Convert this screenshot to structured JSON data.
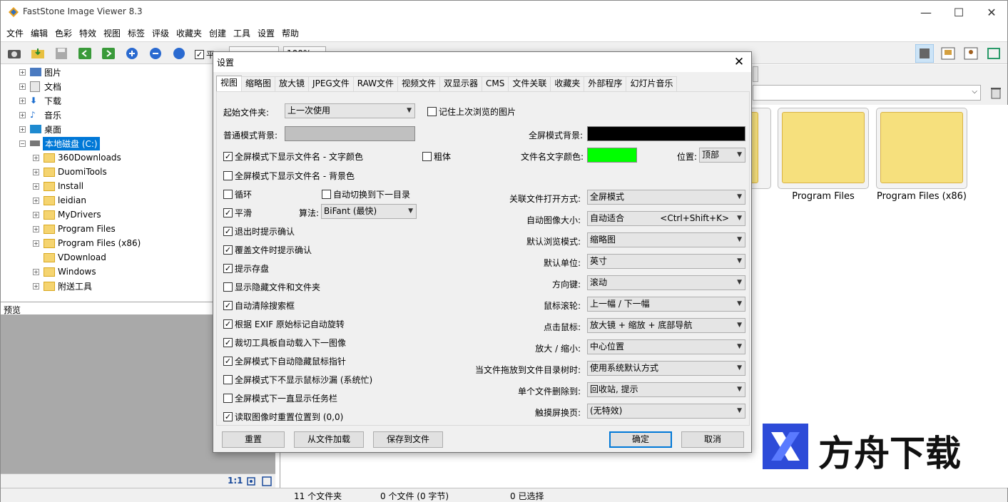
{
  "window": {
    "title": "FastStone Image Viewer 8.3",
    "minimize": "—",
    "maximize": "☐",
    "close": "✕"
  },
  "menu": [
    "文件",
    "编辑",
    "色彩",
    "特效",
    "视图",
    "标签",
    "评级",
    "收藏夹",
    "创建",
    "工具",
    "设置",
    "帮助"
  ],
  "toolbar": {
    "smooth_label": "平",
    "zoom_value": "100%"
  },
  "tree": {
    "top": [
      {
        "label": "图片"
      },
      {
        "label": "文档"
      },
      {
        "label": "下载"
      },
      {
        "label": "音乐"
      },
      {
        "label": "桌面"
      }
    ],
    "drive": "本地磁盘 (C:)",
    "folders": [
      "360Downloads",
      "DuomiTools",
      "Install",
      "leidian",
      "MyDrivers",
      "Program Files",
      "Program Files (x86)",
      "VDownload",
      "Windows",
      "附送工具"
    ]
  },
  "preview": {
    "title": "预览",
    "ratio": "1:1"
  },
  "thumbnails": [
    "Program Files",
    "Program Files (x86)"
  ],
  "status": {
    "folders": "11 个文件夹",
    "files": "0 个文件 (0 字节)",
    "selected": "0 已选择"
  },
  "dialog": {
    "title": "设置",
    "close": "✕",
    "tabs": [
      "视图",
      "缩略图",
      "放大镜",
      "JPEG文件",
      "RAW文件",
      "视频文件",
      "双显示器",
      "CMS",
      "文件关联",
      "收藏夹",
      "外部程序",
      "幻灯片音乐"
    ],
    "start_folder_label": "起始文件夹:",
    "start_folder_value": "上一次使用",
    "remember_last": "记住上次浏览的图片",
    "normal_bg_label": "普通模式背景:",
    "full_bg_label": "全屏模式背景:",
    "show_filename_text": "全屏模式下显示文件名 - 文字颜色",
    "bold": "粗体",
    "filename_color_label": "文件名文字颜色:",
    "position_label": "位置:",
    "position_value": "顶部",
    "show_filename_bg": "全屏模式下显示文件名 - 背景色",
    "loop": "循环",
    "auto_next_dir": "自动切换到下一目录",
    "smooth": "平滑",
    "algo_label": "算法:",
    "algo_value": "BiFant (最快)",
    "checks": [
      {
        "label": "退出时提示确认",
        "checked": true
      },
      {
        "label": "覆盖文件时提示确认",
        "checked": true
      },
      {
        "label": "提示存盘",
        "checked": true
      },
      {
        "label": "显示隐藏文件和文件夹",
        "checked": false
      },
      {
        "label": "自动清除搜索框",
        "checked": true
      },
      {
        "label": "根据 EXIF 原始标记自动旋转",
        "checked": true
      },
      {
        "label": "裁切工具板自动载入下一图像",
        "checked": true
      },
      {
        "label": "全屏模式下自动隐藏鼠标指针",
        "checked": true
      },
      {
        "label": "全屏模式下不显示鼠标沙漏 (系统忙)",
        "checked": false
      },
      {
        "label": "全屏模式下一直显示任务栏",
        "checked": false
      },
      {
        "label": "读取图像时重置位置到 (0,0)",
        "checked": true
      }
    ],
    "right_rows": [
      {
        "label": "关联文件打开方式:",
        "value": "全屏模式"
      },
      {
        "label": "自动图像大小:",
        "value": "自动适合",
        "hint": "<Ctrl+Shift+K>"
      },
      {
        "label": "默认浏览模式:",
        "value": "缩略图"
      },
      {
        "label": "默认单位:",
        "value": "英寸"
      },
      {
        "label": "方向键:",
        "value": "滚动"
      },
      {
        "label": "鼠标滚轮:",
        "value": "上一幅 / 下一幅"
      },
      {
        "label": "点击鼠标:",
        "value": "放大镜 + 缩放 + 底部导航"
      },
      {
        "label": "放大 / 缩小:",
        "value": "中心位置"
      },
      {
        "label": "当文件拖放到文件目录树时:",
        "value": "使用系统默认方式"
      },
      {
        "label": "单个文件删除到:",
        "value": "回收站, 提示"
      },
      {
        "label": "触摸屏换页:",
        "value": "(无特效)"
      }
    ],
    "buttons": {
      "reset": "重置",
      "load": "从文件加载",
      "save": "保存到文件",
      "ok": "确定",
      "cancel": "取消"
    },
    "colors": {
      "normal_bg": "#c0c0c0",
      "full_bg": "#000000",
      "filename_text": "#00ff00"
    }
  },
  "watermark": {
    "text": "方舟下载"
  }
}
